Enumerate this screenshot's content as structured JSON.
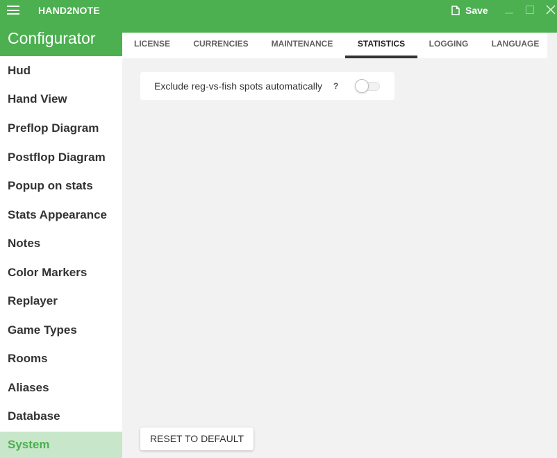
{
  "titlebar": {
    "app_name": "HAND2NOTE",
    "save_label": "Save",
    "menu_icon": "hamburger-menu-icon",
    "save_icon": "document-icon"
  },
  "header": {
    "title": "Configurator"
  },
  "sidebar": {
    "items": [
      {
        "label": "Hud"
      },
      {
        "label": "Hand View"
      },
      {
        "label": "Preflop Diagram"
      },
      {
        "label": "Postflop Diagram"
      },
      {
        "label": "Popup on stats"
      },
      {
        "label": "Stats Appearance"
      },
      {
        "label": "Notes"
      },
      {
        "label": "Color Markers"
      },
      {
        "label": "Replayer"
      },
      {
        "label": "Game Types"
      },
      {
        "label": "Rooms"
      },
      {
        "label": "Aliases"
      },
      {
        "label": "Database"
      },
      {
        "label": "System",
        "active": true
      }
    ]
  },
  "tabs": [
    {
      "label": "LICENSE"
    },
    {
      "label": "CURRENCIES"
    },
    {
      "label": "MAINTENANCE"
    },
    {
      "label": "STATISTICS",
      "active": true
    },
    {
      "label": "LOGGING"
    },
    {
      "label": "LANGUAGE"
    }
  ],
  "settings": {
    "exclude_reg_vs_fish": {
      "label": "Exclude reg-vs-fish spots automatically",
      "help": "?",
      "enabled": false
    }
  },
  "actions": {
    "reset_label": "RESET TO DEFAULT"
  },
  "colors": {
    "accent": "#4caf50",
    "active_item_bg": "#c8e6c9",
    "content_bg": "#f2f2f2"
  }
}
